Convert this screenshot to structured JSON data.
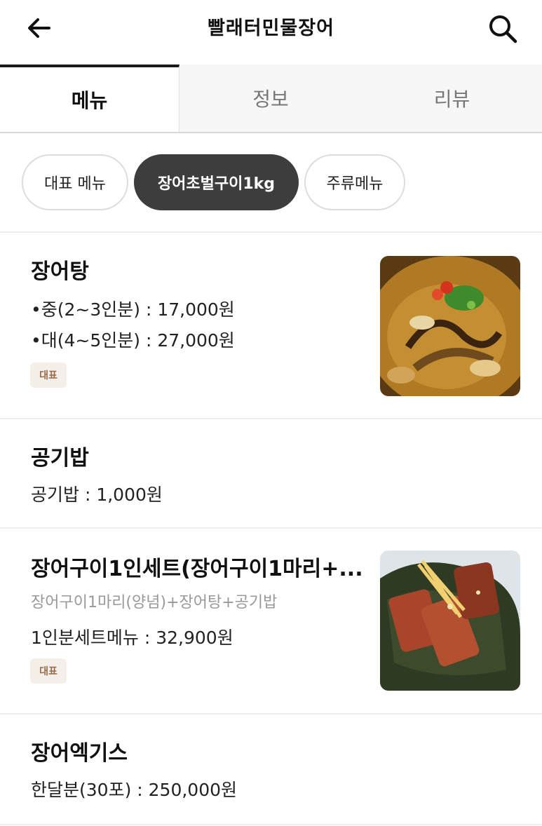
{
  "header": {
    "back_icon": "arrow-left-icon",
    "title": "빨래터민물장어",
    "search_icon": "search-icon"
  },
  "tabs": [
    {
      "label": "메뉴",
      "active": true
    },
    {
      "label": "정보",
      "active": false
    },
    {
      "label": "리뷰",
      "active": false
    }
  ],
  "chips": [
    {
      "label": "대표 메뉴",
      "selected": false
    },
    {
      "label": "장어초벌구이1kg",
      "selected": true
    },
    {
      "label": "주류메뉴",
      "selected": false
    }
  ],
  "menu_items": [
    {
      "name": "장어탕",
      "lines": [
        "•중(2~3인분) : 17,000원",
        "•대(4~5인분) : 27,000원"
      ],
      "badge": "대표",
      "has_image": true
    },
    {
      "name": "공기밥",
      "lines": [
        "공기밥 : 1,000원"
      ]
    },
    {
      "name": "장어구이1인세트(장어구이1마리+...",
      "description": "장어구이1마리(양념)+장어탕+공기밥",
      "lines": [
        "1인분세트메뉴 : 32,900원"
      ],
      "badge": "대표",
      "has_image": true
    },
    {
      "name": "장어엑기스",
      "lines": [
        "한달분(30포) : 250,000원"
      ]
    }
  ],
  "colors": {
    "chip_selected_bg": "#3d3d3d",
    "badge_bg": "#f4efe9",
    "badge_text": "#9a6a4a",
    "divider": "#eeeeee"
  }
}
